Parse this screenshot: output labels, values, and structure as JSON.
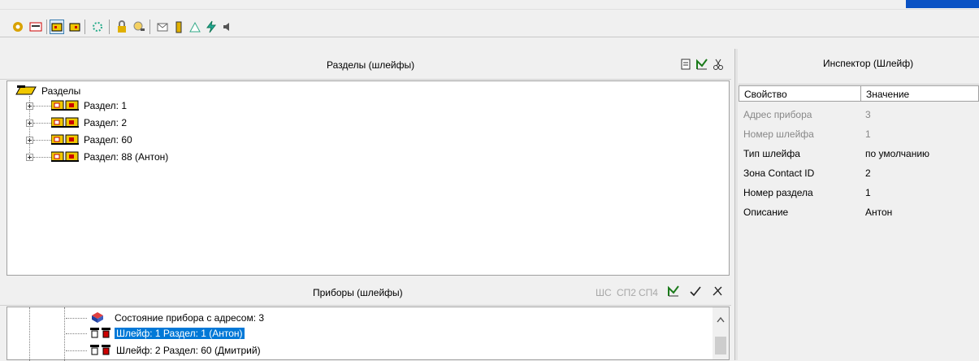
{
  "sections_panel": {
    "title": "Разделы (шлейфы)",
    "root_label": "Разделы",
    "items": [
      {
        "label": "Раздел: 1"
      },
      {
        "label": "Раздел: 2"
      },
      {
        "label": "Раздел: 60"
      },
      {
        "label": "Раздел: 88 (Антон)"
      }
    ]
  },
  "devices_panel": {
    "title": "Приборы  (шлейфы)",
    "filter_labels": {
      "shs": "ШС",
      "sp2": "СП2",
      "sp4": "СП4"
    },
    "items": [
      {
        "label": "Состояние прибора с адресом: 3",
        "selected": false
      },
      {
        "label": "Шлейф: 1 Раздел: 1 (Антон)",
        "selected": true
      },
      {
        "label": "Шлейф: 2 Раздел: 60 (Дмитрий)",
        "selected": false
      }
    ]
  },
  "inspector": {
    "title": "Инспектор (Шлейф)",
    "col_property": "Свойство",
    "col_value": "Значение",
    "rows": [
      {
        "property": "Адрес прибора",
        "value": "3",
        "readonly": true
      },
      {
        "property": "Номер шлейфа",
        "value": "1",
        "readonly": true
      },
      {
        "property": "Тип шлейфа",
        "value": "по умолчанию",
        "readonly": false
      },
      {
        "property": "Зона Contact ID",
        "value": "2",
        "readonly": false
      },
      {
        "property": "Номер раздела",
        "value": "1",
        "readonly": false
      },
      {
        "property": "Описание",
        "value": "Антон",
        "readonly": false
      }
    ]
  },
  "colors": {
    "accent": "#0a52c4",
    "selection": "#0078d7",
    "folder": "#f0c800"
  }
}
